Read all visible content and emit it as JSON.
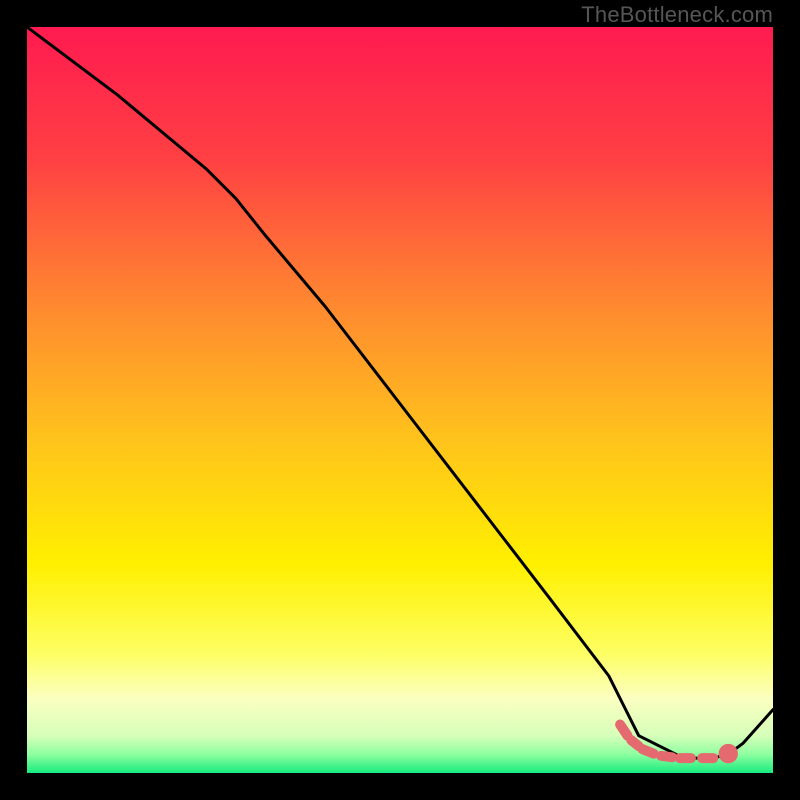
{
  "watermark": "TheBottleneck.com",
  "chart_data": {
    "type": "line",
    "title": "",
    "xlabel": "",
    "ylabel": "",
    "xlim": [
      0,
      100
    ],
    "ylim": [
      0,
      100
    ],
    "gradient_stops": [
      {
        "offset": 0.0,
        "color": "#ff1a50"
      },
      {
        "offset": 0.18,
        "color": "#ff4143"
      },
      {
        "offset": 0.38,
        "color": "#ff8b2f"
      },
      {
        "offset": 0.55,
        "color": "#ffc21c"
      },
      {
        "offset": 0.72,
        "color": "#fff000"
      },
      {
        "offset": 0.84,
        "color": "#fdff63"
      },
      {
        "offset": 0.9,
        "color": "#fbffc1"
      },
      {
        "offset": 0.95,
        "color": "#d6ffb9"
      },
      {
        "offset": 0.975,
        "color": "#8effa0"
      },
      {
        "offset": 1.0,
        "color": "#17eb7e"
      }
    ],
    "series": [
      {
        "name": "curve",
        "color": "#000000",
        "x": [
          0.0,
          12.0,
          24.0,
          28.0,
          32.0,
          40.0,
          50.0,
          60.0,
          70.0,
          78.0,
          80.0,
          82.0,
          88.0,
          92.0,
          94.0,
          96.0,
          100.0
        ],
        "y": [
          100.0,
          91.0,
          81.0,
          77.0,
          72.0,
          62.5,
          49.5,
          36.5,
          23.5,
          13.0,
          9.0,
          5.0,
          2.0,
          2.0,
          2.5,
          4.0,
          8.5
        ]
      }
    ],
    "markers": {
      "name": "dashed-track",
      "color": "#e46a6f",
      "segments": [
        {
          "x0": 79.5,
          "y0": 6.5,
          "x1": 80.5,
          "y1": 5.0
        },
        {
          "x0": 81.0,
          "y0": 4.4,
          "x1": 82.0,
          "y1": 3.6
        },
        {
          "x0": 82.5,
          "y0": 3.2,
          "x1": 84.0,
          "y1": 2.6
        },
        {
          "x0": 85.0,
          "y0": 2.3,
          "x1": 86.5,
          "y1": 2.1
        },
        {
          "x0": 87.5,
          "y0": 2.0,
          "x1": 89.0,
          "y1": 2.0
        },
        {
          "x0": 90.5,
          "y0": 2.0,
          "x1": 92.0,
          "y1": 2.0
        }
      ],
      "dot": {
        "x": 94.0,
        "y": 2.6,
        "r": 1.3
      }
    }
  }
}
